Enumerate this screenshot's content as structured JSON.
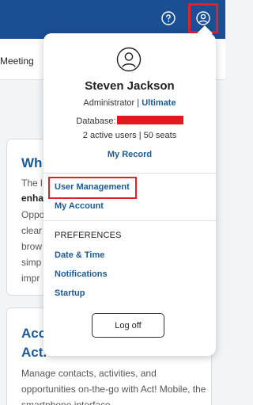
{
  "header": {
    "help_icon": "help-circle-icon",
    "user_icon": "user-circle-icon",
    "background_color": "#1a4f93",
    "highlight_color": "#e0202a"
  },
  "nav": {
    "meeting_label": "Meeting"
  },
  "background_cards": [
    {
      "title": "Wh",
      "lines": [
        "The l",
        "enha",
        "Oppo",
        "clear",
        "brow",
        "simp",
        "impr"
      ]
    },
    {
      "title_lines": [
        "Acc",
        "Act."
      ],
      "body": "Manage contacts, activities, and opportunities on-the-go with Act! Mobile, the smartphone interface"
    }
  ],
  "user_menu": {
    "avatar_icon": "user-avatar-icon",
    "name": "Steven Jackson",
    "role": "Administrator",
    "separator": "|",
    "plan": "Ultimate",
    "database_label": "Database:",
    "users_info": "2 active users | 50 seats",
    "my_record": "My Record",
    "user_management": "User Management",
    "my_account": "My Account",
    "preferences_heading": "PREFERENCES",
    "date_time": "Date & Time",
    "notifications": "Notifications",
    "startup": "Startup",
    "logoff": "Log off",
    "accent_color": "#1a5a96"
  }
}
